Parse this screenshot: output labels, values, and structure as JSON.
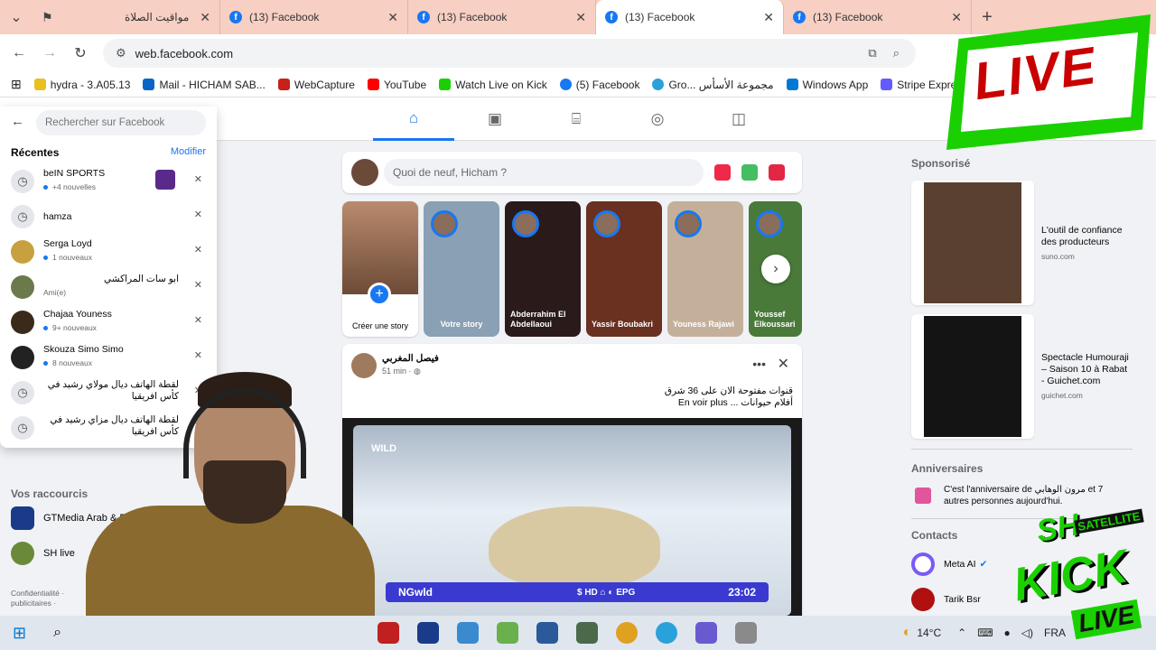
{
  "browser": {
    "tabs": [
      {
        "title": "مواقيت الصلاة"
      },
      {
        "title": "(13) Facebook"
      },
      {
        "title": "(13) Facebook"
      },
      {
        "title": "(13) Facebook"
      },
      {
        "title": "(13) Facebook"
      }
    ],
    "url": "web.facebook.com",
    "bookmarks": [
      {
        "label": "hydra - 3.A05.13",
        "color": "#e8c020"
      },
      {
        "label": "Mail - HICHAM SAB...",
        "color": "#0a64c8"
      },
      {
        "label": "WebCapture",
        "color": "#c8201a"
      },
      {
        "label": "YouTube",
        "color": "#ff0000"
      },
      {
        "label": "Watch Live on Kick",
        "color": "#1ad000"
      },
      {
        "label": "(5) Facebook",
        "color": "#1877f2"
      },
      {
        "label": "Gro... مجموعة الأسأس",
        "color": "#2aa1da"
      },
      {
        "label": "Windows App",
        "color": "#0078d4"
      },
      {
        "label": "Stripe Express",
        "color": "#635bff"
      }
    ]
  },
  "search": {
    "placeholder": "Rechercher sur Facebook",
    "recent_title": "Récentes",
    "edit": "Modifier",
    "items": [
      {
        "name": "beIN SPORTS",
        "sub": "+4 nouvelles",
        "type": "clock",
        "dot": true
      },
      {
        "name": "hamza",
        "sub": "",
        "type": "clock",
        "dot": false
      },
      {
        "name": "Serga Loyd",
        "sub": "1 nouveaux",
        "type": "avatar",
        "color": "#c8a040",
        "dot": true
      },
      {
        "name": "ابو سات المراكشي",
        "sub": "Ami(e)",
        "type": "avatar",
        "color": "#6a7a4a",
        "dot": false
      },
      {
        "name": "Chajaa Youness",
        "sub": "9+ nouveaux",
        "type": "avatar",
        "color": "#3a2a1a",
        "dot": true
      },
      {
        "name": "Skouza Simo Simo",
        "sub": "8 nouveaux",
        "type": "avatar",
        "color": "#222222",
        "dot": true
      },
      {
        "name": "لقطة الهاتف ديال مولاي رشيد في كأس افريقيا",
        "sub": "",
        "type": "clock",
        "dot": false
      },
      {
        "name": "لقطة الهاتف ديال مزاي رشيد في كأس افريقيا",
        "sub": "",
        "type": "clock",
        "dot": false
      }
    ]
  },
  "left": {
    "shortcuts_title": "Vos raccourcis",
    "shortcuts": [
      {
        "label": "GTMedia Arab & Euro",
        "color": "#1a3a8a"
      },
      {
        "label": "SH live",
        "color": "#6a8a3a"
      }
    ],
    "footer": "Confidentialité ·\npublicitaires ·"
  },
  "composer": {
    "placeholder": "Quoi de neuf, Hicham ?"
  },
  "stories": [
    {
      "name": "Créer une story",
      "type": "create"
    },
    {
      "name": "Votre story",
      "color": "#8aa0b4"
    },
    {
      "name": "Abderrahim El Abdellaoui",
      "color": "#2a1a1a"
    },
    {
      "name": "Yassir Boubakri",
      "color": "#6a3020"
    },
    {
      "name": "Youness Rajawi",
      "color": "#c4b09a"
    },
    {
      "name": "Youssef Elkoussari",
      "color": "#4a7a3a"
    }
  ],
  "post": {
    "author": "فيصل المغربي",
    "time": "51 min ·",
    "text_line1": "قنوات مفتوحة الان على 36 شرق",
    "text_line2": "أفلام حيوانات ... En voir plus",
    "video_logo": "WILD",
    "tv_channel": "NGwld",
    "tv_icons": "$ HD ⌂ ◐ EPG",
    "tv_time": "23:02"
  },
  "right": {
    "sponsored": "Sponsorisé",
    "ads": [
      {
        "title": "L'outil de confiance des producteurs",
        "url": "suno.com",
        "color": "#5a4030"
      },
      {
        "title": "Spectacle Humouraji – Saison 10 à Rabat - Guichet.com",
        "url": "guichet.com",
        "color": "#141414"
      }
    ],
    "birthdays_title": "Anniversaires",
    "birthday_text": "C'est l'anniversaire de مرون الوهابي et 7 autres personnes aujourd'hui.",
    "contacts_title": "Contacts",
    "contacts": [
      {
        "name": "Meta AI",
        "color": "#7a5af8"
      },
      {
        "name": "Tarik Bsr",
        "color": "#b01010"
      }
    ]
  },
  "taskbar": {
    "weather": "14°C",
    "lang": "FRA"
  },
  "overlay": {
    "live": "LIVE",
    "sh": "SH",
    "satellite": "SATELLITE",
    "kick": "KICK",
    "live2": "LIVE"
  }
}
